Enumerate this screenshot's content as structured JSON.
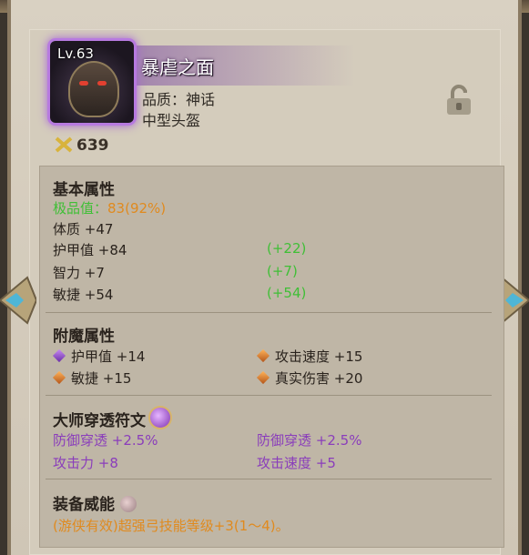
{
  "item": {
    "level": "Lv.63",
    "name": "暴虐之面",
    "quality": "品质：神话",
    "type": "中型头盔",
    "score": "639"
  },
  "base": {
    "title": "基本属性",
    "perfect_label": "极品值：",
    "perfect_value": "83(92%)",
    "rows": [
      {
        "label": "体质 +47",
        "bonus": ""
      },
      {
        "label": "护甲值 +84",
        "bonus": "(+22)"
      },
      {
        "label": "智力 +7",
        "bonus": "(+7)"
      },
      {
        "label": "敏捷 +54",
        "bonus": "(+54)"
      }
    ]
  },
  "enchant": {
    "title": "附魔属性",
    "items": [
      {
        "text": "护甲值 +14",
        "gem": "purple"
      },
      {
        "text": "攻击速度 +15",
        "gem": "orange"
      },
      {
        "text": "敏捷 +15",
        "gem": "orange"
      },
      {
        "text": "真实伤害 +20",
        "gem": "orange"
      }
    ]
  },
  "rune": {
    "title": "大师穿透符文",
    "items": [
      "防御穿透 +2.5%",
      "防御穿透 +2.5%",
      "攻击力 +8",
      "攻击速度 +5"
    ]
  },
  "power": {
    "title": "装备威能",
    "desc": "(游侠有效)超强弓技能等级+3(1～4)。"
  },
  "colors": {
    "mythic_glow": "#b77ae0",
    "green": "#3fbf36",
    "orange": "#e08a1e",
    "purple": "#8a3dbb"
  }
}
